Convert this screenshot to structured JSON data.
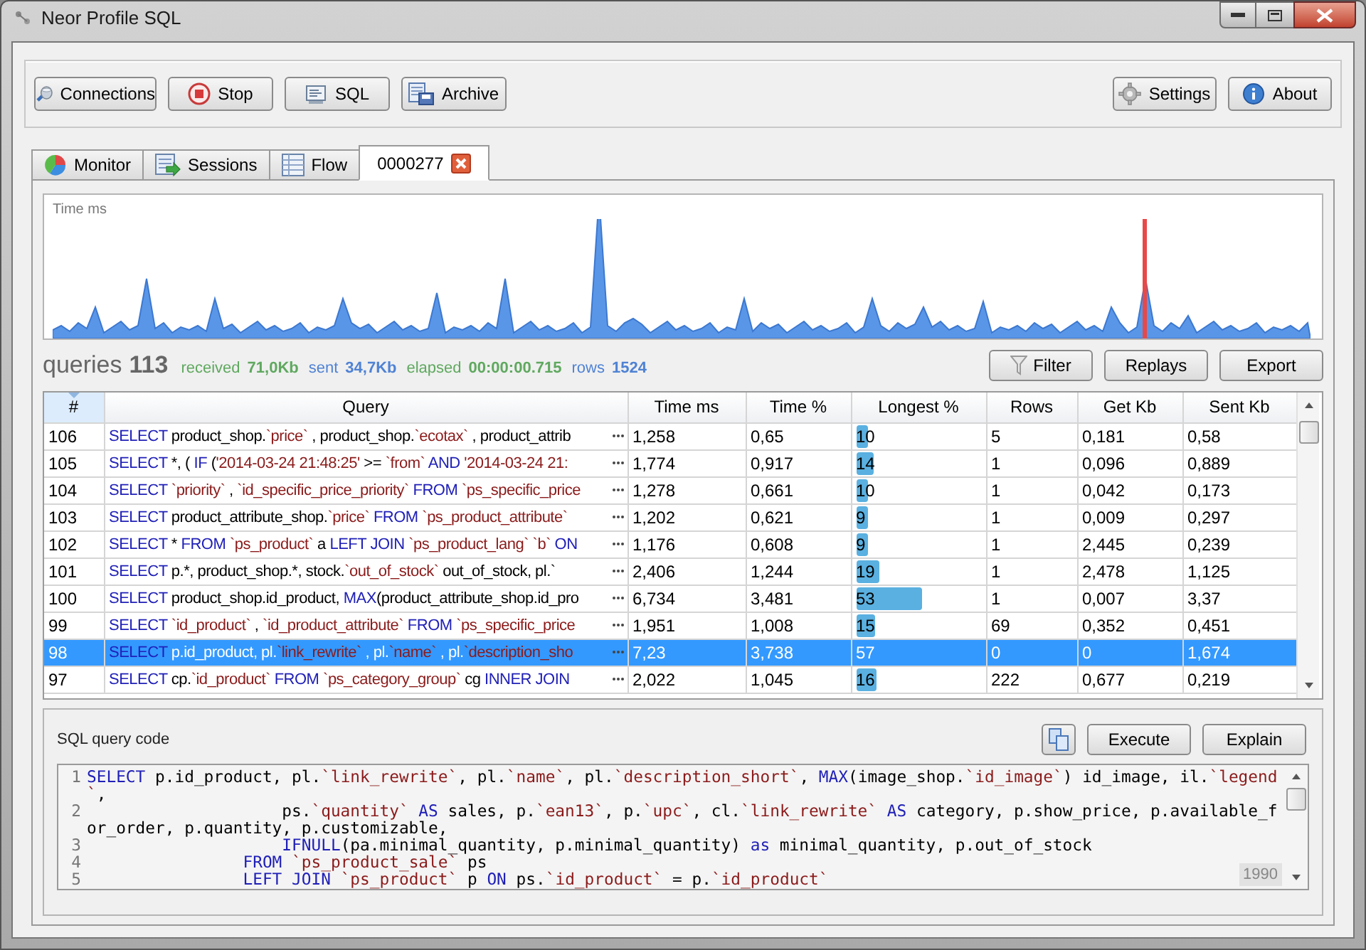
{
  "window": {
    "title": "Neor Profile SQL"
  },
  "toolbar": {
    "left": [
      {
        "label": "Connections"
      },
      {
        "label": "Stop"
      },
      {
        "label": "SQL"
      },
      {
        "label": "Archive"
      }
    ],
    "right": [
      {
        "label": "Settings"
      },
      {
        "label": "About"
      }
    ]
  },
  "tabs": [
    {
      "label": "Monitor",
      "selected": false,
      "closable": false
    },
    {
      "label": "Sessions",
      "selected": false,
      "closable": false
    },
    {
      "label": "Flow",
      "selected": false,
      "closable": false
    },
    {
      "label": "0000277",
      "selected": true,
      "closable": true
    }
  ],
  "chart": {
    "title": "Time ms"
  },
  "stats": {
    "title": "queries",
    "count": "113",
    "items": [
      {
        "label": "received",
        "value": "71,0Kb",
        "color": "#5fa85f"
      },
      {
        "label": "sent",
        "value": "34,7Kb",
        "color": "#4f82d4"
      },
      {
        "label": "elapsed",
        "value": "00:00:00.715",
        "color": "#5fa85f"
      },
      {
        "label": "rows",
        "value": "1524",
        "color": "#4f82d4"
      }
    ]
  },
  "actions": [
    "Filter",
    "Replays",
    "Export"
  ],
  "table": {
    "columns": [
      "#",
      "Query",
      "Time ms",
      "Time %",
      "Longest %",
      "Rows",
      "Get Kb",
      "Sent Kb"
    ],
    "rows": [
      {
        "number": "106",
        "query": [
          {
            "kind": "keyword",
            "text": "SELECT"
          },
          {
            "kind": "plain",
            "text": " product_shop."
          },
          {
            "kind": "identifier",
            "text": "`price`"
          },
          {
            "kind": "plain",
            "text": " , product_shop."
          },
          {
            "kind": "identifier",
            "text": "`ecotax`"
          },
          {
            "kind": "plain",
            "text": " , product_attrib"
          }
        ],
        "time_ms": "1,258",
        "time_pct": "0,65",
        "longest": "10",
        "level": 0.1,
        "rows": "5",
        "get_kb": "0,181",
        "sent_kb": "0,58",
        "selected": false
      },
      {
        "number": "105",
        "query": [
          {
            "kind": "keyword",
            "text": "SELECT"
          },
          {
            "kind": "plain",
            "text": " *, ( "
          },
          {
            "kind": "keyword",
            "text": "IF"
          },
          {
            "kind": "plain",
            "text": " ("
          },
          {
            "kind": "identifier",
            "text": "'2014-03-24 21:48:25'"
          },
          {
            "kind": "plain",
            "text": " >= "
          },
          {
            "kind": "identifier",
            "text": "`from`"
          },
          {
            "kind": "keyword",
            "text": " AND "
          },
          {
            "kind": "identifier",
            "text": "'2014-03-24 21:"
          }
        ],
        "time_ms": "1,774",
        "time_pct": "0,917",
        "longest": "14",
        "level": 0.14,
        "rows": "1",
        "get_kb": "0,096",
        "sent_kb": "0,889",
        "selected": false
      },
      {
        "number": "104",
        "query": [
          {
            "kind": "keyword",
            "text": "SELECT "
          },
          {
            "kind": "identifier",
            "text": "`priority`"
          },
          {
            "kind": "plain",
            "text": " , "
          },
          {
            "kind": "identifier",
            "text": "`id_specific_price_priority`"
          },
          {
            "kind": "keyword",
            "text": " FROM "
          },
          {
            "kind": "identifier",
            "text": "`ps_specific_price"
          }
        ],
        "time_ms": "1,278",
        "time_pct": "0,661",
        "longest": "10",
        "level": 0.1,
        "rows": "1",
        "get_kb": "0,042",
        "sent_kb": "0,173",
        "selected": false
      },
      {
        "number": "103",
        "query": [
          {
            "kind": "keyword",
            "text": "SELECT"
          },
          {
            "kind": "plain",
            "text": " product_attribute_shop."
          },
          {
            "kind": "identifier",
            "text": "`price`"
          },
          {
            "kind": "keyword",
            "text": " FROM "
          },
          {
            "kind": "identifier",
            "text": "`ps_product_attribute`"
          }
        ],
        "time_ms": "1,202",
        "time_pct": "0,621",
        "longest": "9",
        "level": 0.09,
        "rows": "1",
        "get_kb": "0,009",
        "sent_kb": "0,297",
        "selected": false
      },
      {
        "number": "102",
        "query": [
          {
            "kind": "keyword",
            "text": "SELECT"
          },
          {
            "kind": "plain",
            "text": " * "
          },
          {
            "kind": "keyword",
            "text": "FROM "
          },
          {
            "kind": "identifier",
            "text": "`ps_product`"
          },
          {
            "kind": "plain",
            "text": " a "
          },
          {
            "kind": "keyword",
            "text": "LEFT JOIN "
          },
          {
            "kind": "identifier",
            "text": "`ps_product_lang` `b`"
          },
          {
            "kind": "keyword",
            "text": " ON"
          }
        ],
        "time_ms": "1,176",
        "time_pct": "0,608",
        "longest": "9",
        "level": 0.09,
        "rows": "1",
        "get_kb": "2,445",
        "sent_kb": "0,239",
        "selected": false
      },
      {
        "number": "101",
        "query": [
          {
            "kind": "keyword",
            "text": "SELECT"
          },
          {
            "kind": "plain",
            "text": " p.*, product_shop.*, stock."
          },
          {
            "kind": "identifier",
            "text": "`out_of_stock`"
          },
          {
            "kind": "plain",
            "text": " out_of_stock, pl.`"
          }
        ],
        "time_ms": "2,406",
        "time_pct": "1,244",
        "longest": "19",
        "level": 0.19,
        "rows": "1",
        "get_kb": "2,478",
        "sent_kb": "1,125",
        "selected": false
      },
      {
        "number": "100",
        "query": [
          {
            "kind": "keyword",
            "text": "SELECT"
          },
          {
            "kind": "plain",
            "text": " product_shop.id_product, "
          },
          {
            "kind": "keyword",
            "text": "MAX"
          },
          {
            "kind": "plain",
            "text": "(product_attribute_shop.id_pro"
          }
        ],
        "time_ms": "6,734",
        "time_pct": "3,481",
        "longest": "53",
        "level": 0.53,
        "rows": "1",
        "get_kb": "0,007",
        "sent_kb": "3,37",
        "selected": false
      },
      {
        "number": "99",
        "query": [
          {
            "kind": "keyword",
            "text": "SELECT "
          },
          {
            "kind": "identifier",
            "text": "`id_product`"
          },
          {
            "kind": "plain",
            "text": " , "
          },
          {
            "kind": "identifier",
            "text": "`id_product_attribute`"
          },
          {
            "kind": "keyword",
            "text": " FROM "
          },
          {
            "kind": "identifier",
            "text": "`ps_specific_price"
          }
        ],
        "time_ms": "1,951",
        "time_pct": "1,008",
        "longest": "15",
        "level": 0.15,
        "rows": "69",
        "get_kb": "0,352",
        "sent_kb": "0,451",
        "selected": false
      },
      {
        "number": "98",
        "query": [
          {
            "kind": "keyword",
            "text": "SELECT"
          },
          {
            "kind": "plain",
            "text": " p.id_product, pl."
          },
          {
            "kind": "identifier",
            "text": "`link_rewrite`"
          },
          {
            "kind": "plain",
            "text": " , pl."
          },
          {
            "kind": "identifier",
            "text": "`name`"
          },
          {
            "kind": "plain",
            "text": " , pl."
          },
          {
            "kind": "identifier",
            "text": "`description_sho"
          }
        ],
        "time_ms": "7,23",
        "time_pct": "3,738",
        "longest": "57",
        "level": 0.57,
        "rows": "0",
        "get_kb": "0",
        "sent_kb": "1,674",
        "selected": true
      },
      {
        "number": "97",
        "query": [
          {
            "kind": "keyword",
            "text": "SELECT"
          },
          {
            "kind": "plain",
            "text": " cp."
          },
          {
            "kind": "identifier",
            "text": "`id_product`"
          },
          {
            "kind": "keyword",
            "text": " FROM "
          },
          {
            "kind": "identifier",
            "text": "`ps_category_group`"
          },
          {
            "kind": "plain",
            "text": " cg "
          },
          {
            "kind": "keyword",
            "text": "INNER JOIN"
          }
        ],
        "time_ms": "2,022",
        "time_pct": "1,045",
        "longest": "16",
        "level": 0.16,
        "rows": "222",
        "get_kb": "0,677",
        "sent_kb": "0,219",
        "selected": false
      }
    ]
  },
  "sql_panel": {
    "title": "SQL query code",
    "buttons": [
      "Execute",
      "Explain"
    ],
    "counter": "1990",
    "lines": [
      {
        "number": "1",
        "segments": [
          {
            "kind": "keyword",
            "text": "SELECT"
          },
          {
            "kind": "plain",
            "text": " p.id_product, pl."
          },
          {
            "kind": "identifier",
            "text": "`link_rewrite`"
          },
          {
            "kind": "plain",
            "text": ", pl."
          },
          {
            "kind": "identifier",
            "text": "`name`"
          },
          {
            "kind": "plain",
            "text": ", pl."
          },
          {
            "kind": "identifier",
            "text": "`description_short`"
          },
          {
            "kind": "plain",
            "text": ", "
          },
          {
            "kind": "keyword",
            "text": "MAX"
          },
          {
            "kind": "plain",
            "text": "(image_shop."
          },
          {
            "kind": "identifier",
            "text": "`id_image`"
          },
          {
            "kind": "plain",
            "text": ") id_image, il."
          },
          {
            "kind": "identifier",
            "text": "`legend`"
          },
          {
            "kind": "plain",
            "text": ","
          }
        ]
      },
      {
        "number": "2",
        "segments": [
          {
            "kind": "plain",
            "text": "                    ps."
          },
          {
            "kind": "identifier",
            "text": "`quantity`"
          },
          {
            "kind": "keyword",
            "text": " AS"
          },
          {
            "kind": "plain",
            "text": " sales, p."
          },
          {
            "kind": "identifier",
            "text": "`ean13`"
          },
          {
            "kind": "plain",
            "text": ", p."
          },
          {
            "kind": "identifier",
            "text": "`upc`"
          },
          {
            "kind": "plain",
            "text": ", cl."
          },
          {
            "kind": "identifier",
            "text": "`link_rewrite`"
          },
          {
            "kind": "keyword",
            "text": " AS"
          },
          {
            "kind": "plain",
            "text": " category, p.show_price, p.available_for_order, p.quantity, p.customizable,"
          }
        ]
      },
      {
        "number": "3",
        "segments": [
          {
            "kind": "keyword",
            "text": "                    IFNULL"
          },
          {
            "kind": "plain",
            "text": "(pa.minimal_quantity, p.minimal_quantity) "
          },
          {
            "kind": "keyword",
            "text": "as"
          },
          {
            "kind": "plain",
            "text": " minimal_quantity, p.out_of_stock"
          }
        ]
      },
      {
        "number": "4",
        "segments": [
          {
            "kind": "keyword",
            "text": "                FROM"
          },
          {
            "kind": "identifier",
            "text": " `ps_product_sale`"
          },
          {
            "kind": "plain",
            "text": " ps"
          }
        ]
      },
      {
        "number": "5",
        "segments": [
          {
            "kind": "keyword",
            "text": "                LEFT JOIN"
          },
          {
            "kind": "identifier",
            "text": " `ps_product`"
          },
          {
            "kind": "plain",
            "text": " p "
          },
          {
            "kind": "keyword",
            "text": "ON"
          },
          {
            "kind": "plain",
            "text": " ps."
          },
          {
            "kind": "identifier",
            "text": "`id_product`"
          },
          {
            "kind": "plain",
            "text": " = p."
          },
          {
            "kind": "identifier",
            "text": "`id_product`"
          }
        ]
      }
    ]
  }
}
